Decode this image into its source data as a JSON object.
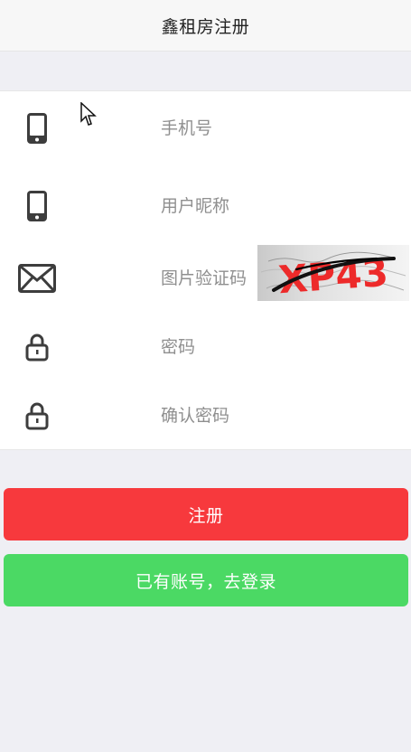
{
  "header": {
    "title": "鑫租房注册"
  },
  "form": {
    "phone": {
      "icon": "smartphone-icon",
      "placeholder": "手机号",
      "value": ""
    },
    "nickname": {
      "icon": "smartphone-icon",
      "placeholder": "用户昵称",
      "value": ""
    },
    "captcha": {
      "icon": "mail-icon",
      "placeholder": "图片验证码",
      "value": "",
      "image_text": "XP43"
    },
    "password": {
      "icon": "lock-icon",
      "placeholder": "密码",
      "value": ""
    },
    "confirm_password": {
      "icon": "lock-icon",
      "placeholder": "确认密码",
      "value": ""
    }
  },
  "buttons": {
    "register": "注册",
    "login": "已有账号，去登录"
  },
  "colors": {
    "background": "#efeff4",
    "header": "#f7f7f7",
    "register": "#f7393d",
    "login": "#4bd964",
    "placeholder": "#8f8f8f"
  }
}
